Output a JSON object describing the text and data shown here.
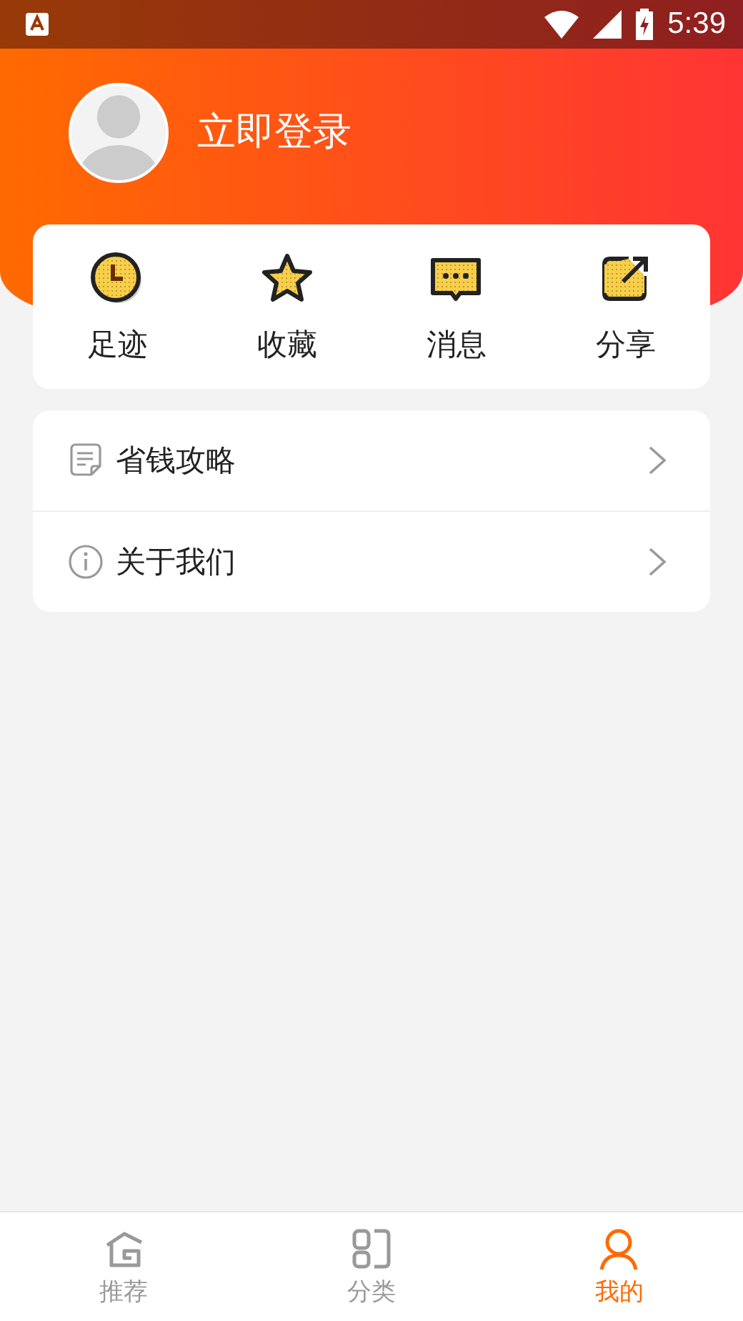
{
  "status_bar": {
    "time": "5:39"
  },
  "profile": {
    "login_label": "立即登录"
  },
  "shortcuts": [
    {
      "label": "足迹"
    },
    {
      "label": "收藏"
    },
    {
      "label": "消息"
    },
    {
      "label": "分享"
    }
  ],
  "menu": [
    {
      "label": "省钱攻略"
    },
    {
      "label": "关于我们"
    }
  ],
  "bottom_nav": [
    {
      "label": "推荐",
      "selected": false
    },
    {
      "label": "分类",
      "selected": false
    },
    {
      "label": "我的",
      "selected": true
    }
  ]
}
